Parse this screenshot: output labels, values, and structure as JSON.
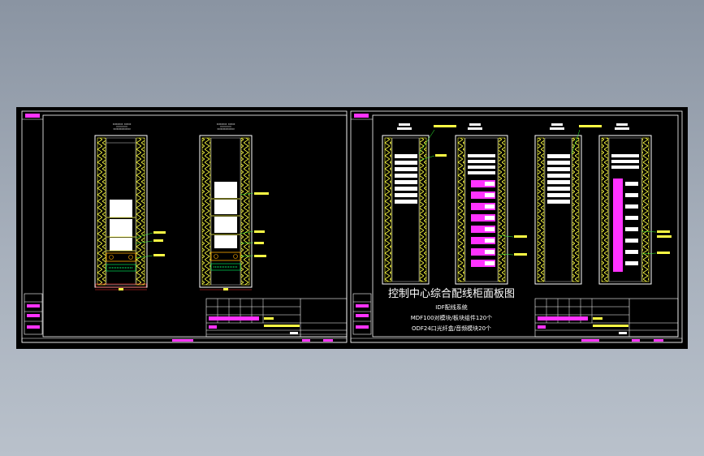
{
  "drawing": {
    "main_title": "控制中心综合配线柜面板图",
    "system_lines": [
      "IDF配线系统",
      "MDF100对模块/板块组件120个",
      "ODF24口光纤盒/音频模块20个"
    ]
  },
  "colors": {
    "background_canvas": "#000000",
    "frame": "#ffffff",
    "hatch": "#ffff33",
    "rail": "#00ff66",
    "module": "#ff33ff",
    "leader": "#33ff33",
    "dimension": "#ff3333"
  }
}
